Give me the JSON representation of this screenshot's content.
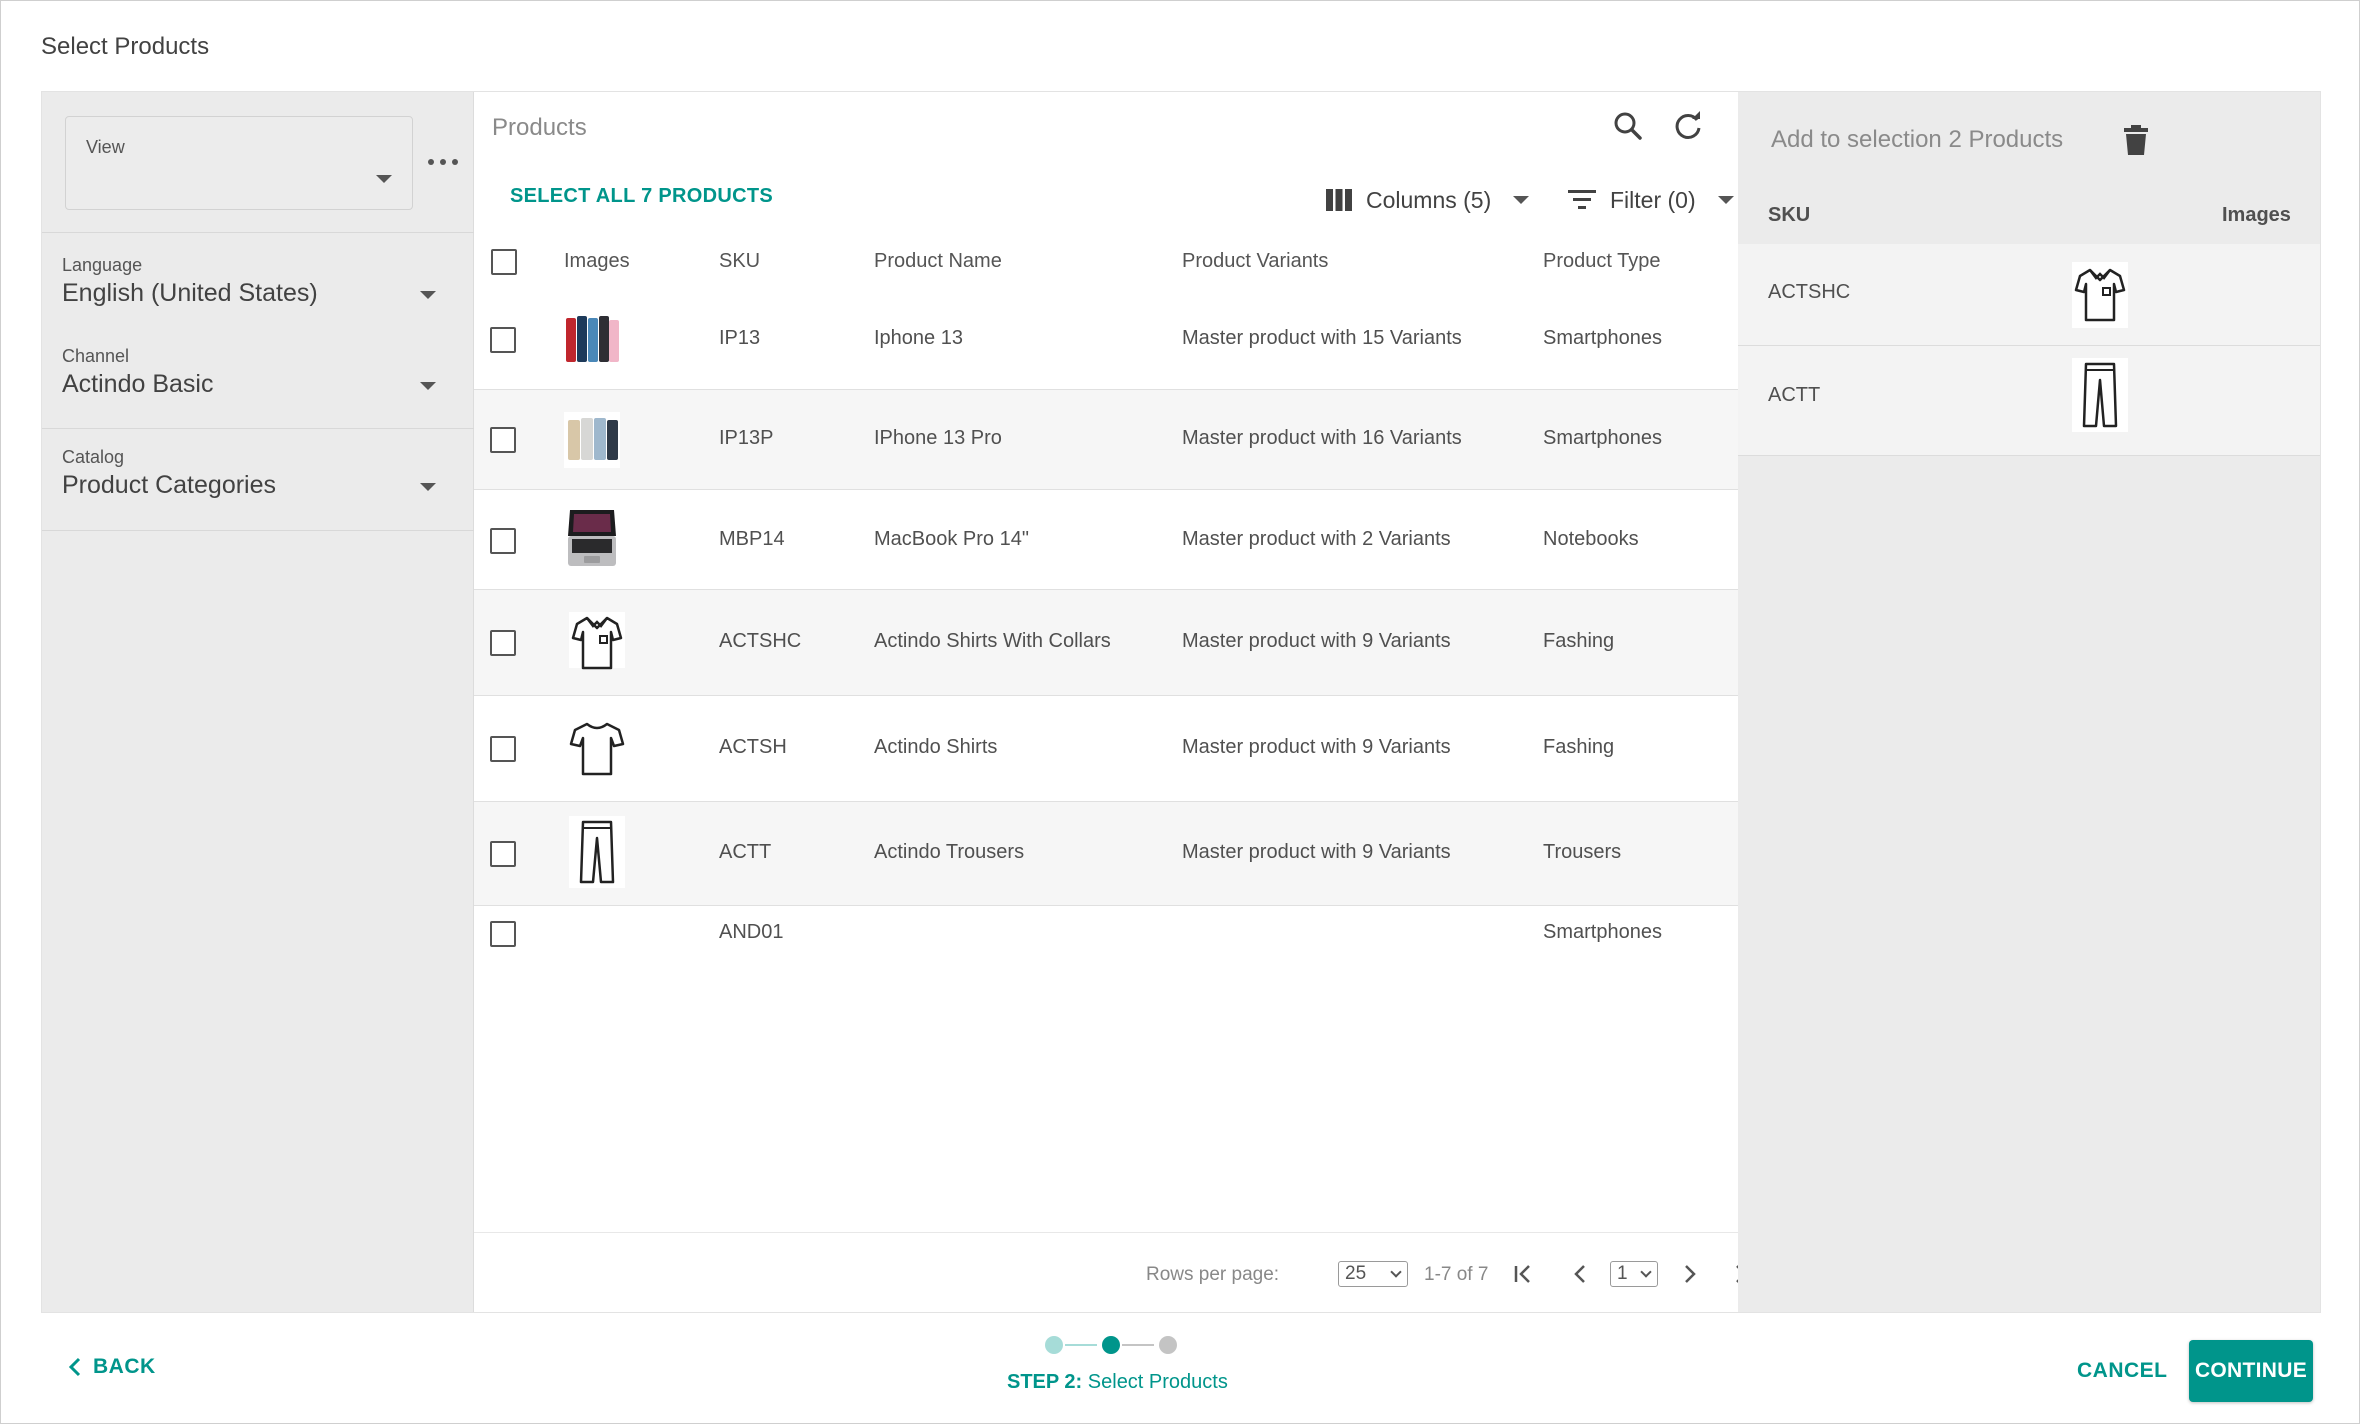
{
  "dialog": {
    "title": "Select Products"
  },
  "filters": {
    "view_label": "View",
    "view_value": "",
    "language_label": "Language",
    "language_value": "English (United States)",
    "channel_label": "Channel",
    "channel_value": "Actindo Basic",
    "catalog_label": "Catalog",
    "catalog_value": "Product Categories"
  },
  "products": {
    "title": "Products",
    "select_all": "SELECT ALL 7 PRODUCTS",
    "columns_label": "Columns (5)",
    "filter_label": "Filter (0)",
    "headers": [
      "Images",
      "SKU",
      "Product Name",
      "Product Variants",
      "Product Type"
    ],
    "rows": [
      {
        "sku": "IP13",
        "name": "Iphone 13",
        "variants": "Master product with 15 Variants",
        "type": "Smartphones",
        "image": "iphone-13-image"
      },
      {
        "sku": "IP13P",
        "name": "IPhone 13 Pro",
        "variants": "Master product with 16 Variants",
        "type": "Smartphones",
        "image": "iphone-13-pro-image"
      },
      {
        "sku": "MBP14",
        "name": "MacBook Pro 14\"",
        "variants": "Master product with 2 Variants",
        "type": "Notebooks",
        "image": "macbook-image"
      },
      {
        "sku": "ACTSHC",
        "name": "Actindo Shirts With Collars",
        "variants": "Master product with 9 Variants",
        "type": "Fashing",
        "image": "polo-shirt-icon"
      },
      {
        "sku": "ACTSH",
        "name": "Actindo Shirts",
        "variants": "Master product with 9 Variants",
        "type": "Fashing",
        "image": "tshirt-icon"
      },
      {
        "sku": "ACTT",
        "name": "Actindo Trousers",
        "variants": "Master product with 9 Variants",
        "type": "Trousers",
        "image": "trousers-icon"
      },
      {
        "sku": "AND01",
        "name": "",
        "variants": "",
        "type": "Smartphones",
        "image": ""
      }
    ],
    "footer": {
      "rows_per_page_label": "Rows per page:",
      "rows_per_page_value": "25",
      "range": "1-7 of 7",
      "page_value": "1"
    }
  },
  "selection": {
    "title": "Add to selection 2 Products",
    "headers": [
      "SKU",
      "Images"
    ],
    "items": [
      {
        "sku": "ACTSHC",
        "image": "polo-shirt-icon"
      },
      {
        "sku": "ACTT",
        "image": "trousers-icon"
      }
    ]
  },
  "wizard": {
    "back_label": "BACK",
    "step_prefix": "STEP 2:",
    "step_name": "Select Products",
    "cancel_label": "CANCEL",
    "continue_label": "CONTINUE",
    "current_step": 2,
    "total_steps": 3
  },
  "colors": {
    "accent": "#00958b",
    "accent_light": "#a6dcd8",
    "step_inactive": "#c4c4c4"
  }
}
